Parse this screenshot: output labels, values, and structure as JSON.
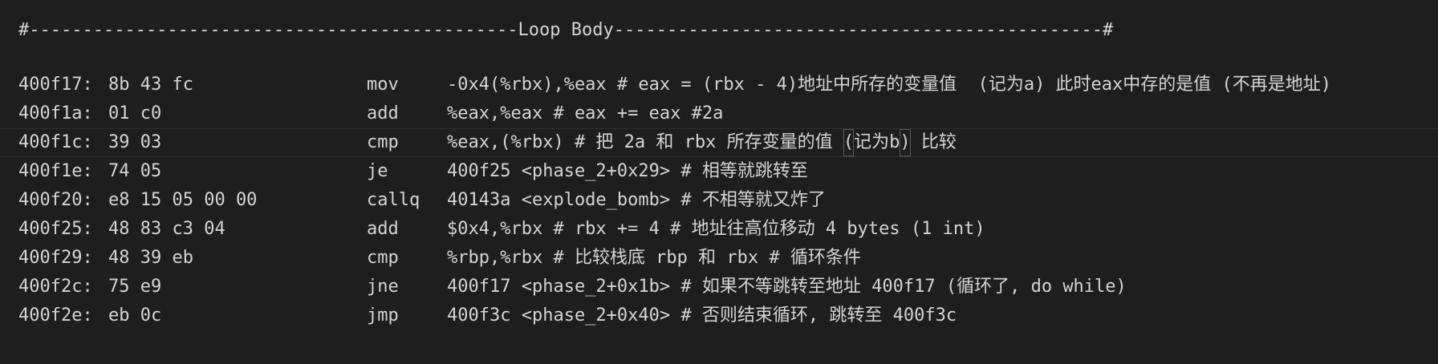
{
  "header": "#----------------------------------------------Loop Body----------------------------------------------#",
  "rows": [
    {
      "addr": "400f17:",
      "bytes": "8b 43 fc",
      "op": "mov",
      "args": "-0x4(%rbx),%eax # eax = (rbx - 4)地址中所存的变量值  (记为a) 此时eax中存的是值 (不再是地址)"
    },
    {
      "addr": "400f1a:",
      "bytes": "01 c0",
      "op": "add",
      "args": "%eax,%eax # eax += eax #2a"
    },
    {
      "addr": "400f1c:",
      "bytes": "39 03",
      "op": "cmp",
      "args_pre": "%eax,(%rbx) # 把 2a 和 rbx 所存变量的值 ",
      "args_box1": "(",
      "args_mid": "记为b",
      "args_box2": ")",
      "args_post": " 比较"
    },
    {
      "addr": "400f1e:",
      "bytes": "74 05",
      "op": "je",
      "args": "400f25 <phase_2+0x29> # 相等就跳转至"
    },
    {
      "addr": "400f20:",
      "bytes": "e8 15 05 00 00",
      "op": "callq",
      "args": "40143a <explode_bomb> # 不相等就又炸了"
    },
    {
      "addr": "400f25:",
      "bytes": "48 83 c3 04",
      "op": "add",
      "args": "$0x4,%rbx # rbx += 4 # 地址往高位移动 4 bytes (1 int)"
    },
    {
      "addr": "400f29:",
      "bytes": "48 39 eb",
      "op": "cmp",
      "args": "%rbp,%rbx # 比较栈底 rbp 和 rbx # 循环条件"
    },
    {
      "addr": "400f2c:",
      "bytes": "75 e9",
      "op": "jne",
      "args": "400f17 <phase_2+0x1b> # 如果不等跳转至地址 400f17 (循环了, do while)"
    },
    {
      "addr": "400f2e:",
      "bytes": "eb 0c",
      "op": "jmp",
      "args": "400f3c <phase_2+0x40> # 否则结束循环, 跳转至 400f3c"
    }
  ]
}
